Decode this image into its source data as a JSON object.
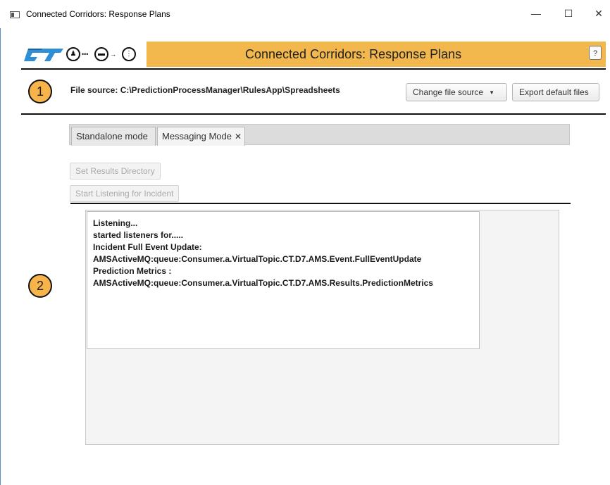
{
  "window": {
    "title": "Connected Corridors: Response Plans",
    "controls": {
      "minimize": "—",
      "maximize": "☐",
      "close": "✕"
    }
  },
  "header": {
    "app_title": "Connected Corridors: Response Plans",
    "help_label": "?",
    "accent_color": "#f2b84d"
  },
  "badges": {
    "one": "1",
    "two": "2"
  },
  "file_source": {
    "text": "File source: C:\\PredictionProcessManager\\RulesApp\\Spreadsheets",
    "change_button": "Change file source",
    "export_button": "Export default files"
  },
  "tabs": [
    {
      "label": "Standalone mode"
    },
    {
      "label": "Messaging Mode",
      "close": "✕"
    }
  ],
  "actions": {
    "set_results": "Set Results Directory",
    "start_listening": "Start Listening for Incident"
  },
  "log": {
    "lines": [
      "Listening...",
      "started listeners for.....",
      "Incident Full Event Update:",
      "AMSActiveMQ:queue:Consumer.a.VirtualTopic.CT.D7.AMS.Event.FullEventUpdate",
      "Prediction Metrics :",
      "AMSActiveMQ:queue:Consumer.a.VirtualTopic.CT.D7.AMS.Results.PredictionMetrics"
    ]
  }
}
